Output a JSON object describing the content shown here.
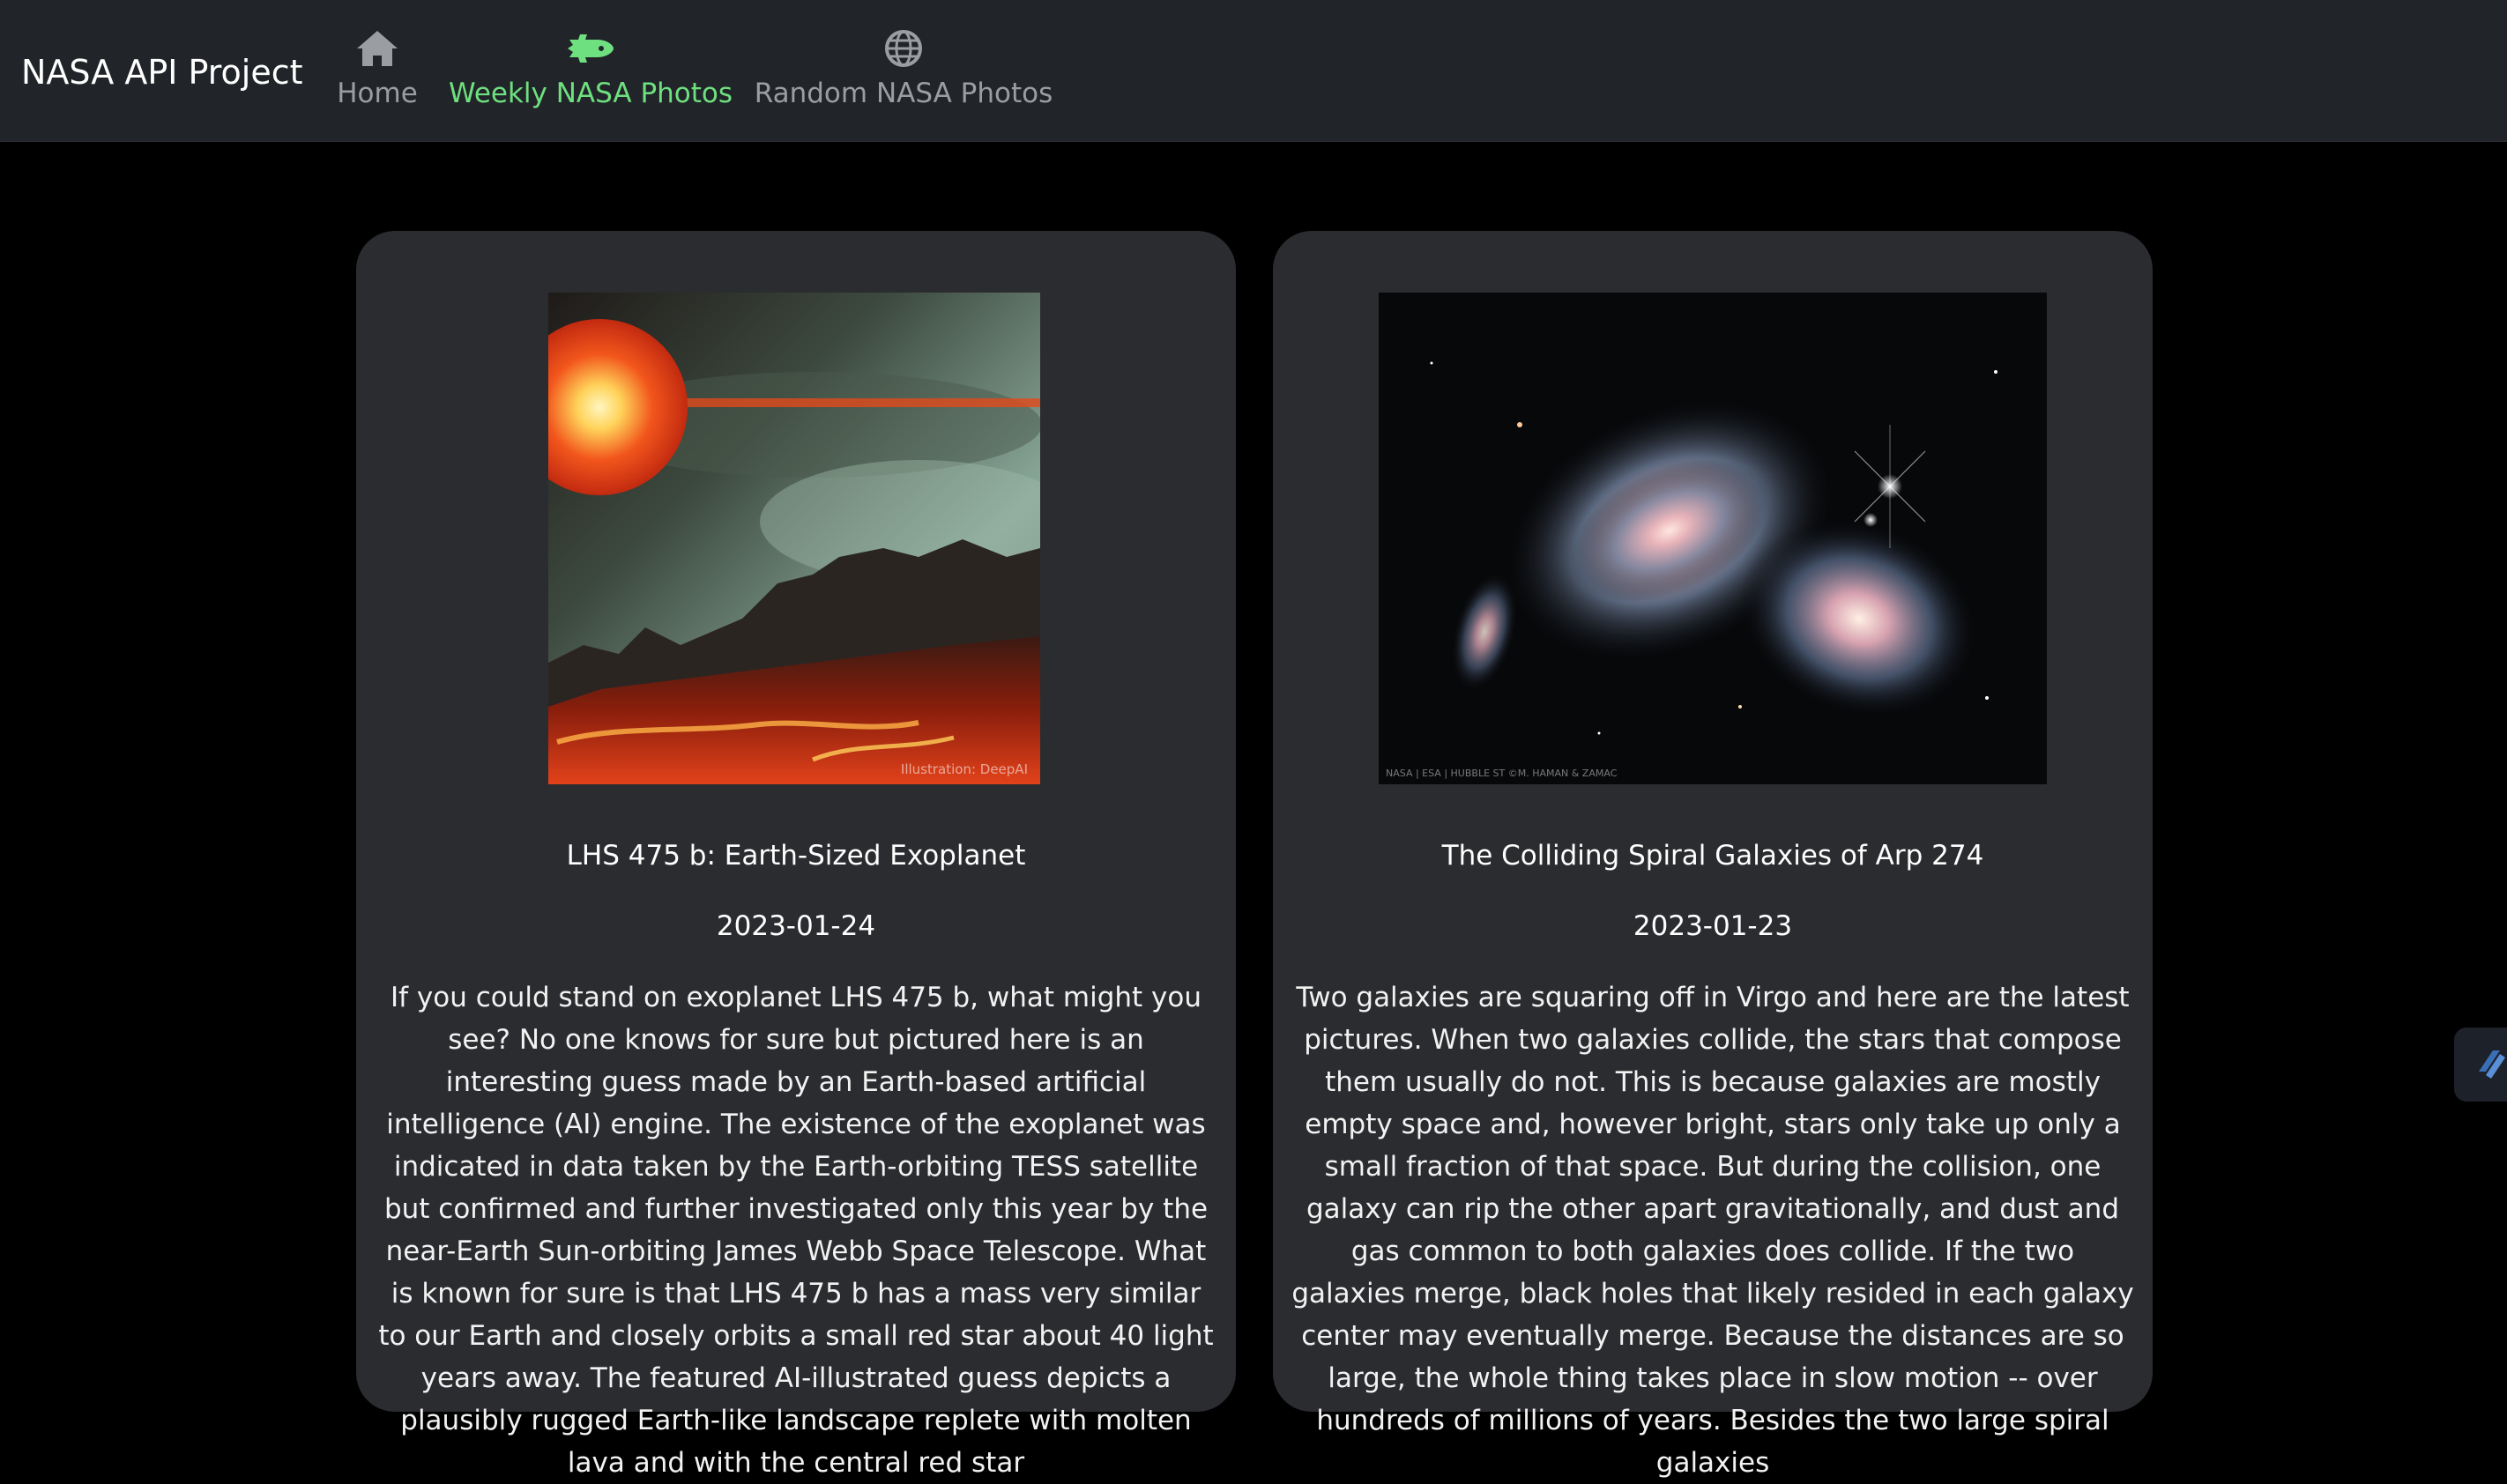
{
  "navbar": {
    "brand": "NASA API Project",
    "items": [
      {
        "label": "Home",
        "icon": "home-icon",
        "active": false
      },
      {
        "label": "Weekly NASA Photos",
        "icon": "space-shuttle-icon",
        "active": true
      },
      {
        "label": "Random NASA Photos",
        "icon": "globe-icon",
        "active": false
      }
    ],
    "active_color": "#6fe07f",
    "inactive_color": "#9a9da1",
    "background": "#212529"
  },
  "cards": [
    {
      "title": "LHS 475 b: Earth-Sized Exoplanet",
      "date": "2023-01-24",
      "image_credit": "Illustration: DeepAI",
      "description": "If you could stand on exoplanet LHS 475 b, what might you see? No one knows for sure but pictured here is an interesting guess made by an Earth-based artificial intelligence (AI) engine. The existence of the exoplanet was indicated in data taken by the Earth-orbiting TESS satellite but confirmed and further investigated only this year by the near-Earth Sun-orbiting James Webb Space Telescope. What is known for sure is that LHS 475 b has a mass very similar to our Earth and closely orbits a small red star about 40 light years away. The featured AI-illustrated guess depicts a plausibly rugged Earth-like landscape replete with molten lava and with the central red star"
    },
    {
      "title": "The Colliding Spiral Galaxies of Arp 274",
      "date": "2023-01-23",
      "image_credit": "NASA | ESA | HUBBLE ST ©M. HAMAN & ZAMAC",
      "description": "Two galaxies are squaring off in Virgo and here are the latest pictures. When two galaxies collide, the stars that compose them usually do not. This is because galaxies are mostly empty space and, however bright, stars only take up only a small fraction of that space. But during the collision, one galaxy can rip the other apart gravitationally, and dust and gas common to both galaxies does collide. If the two galaxies merge, black holes that likely resided in each galaxy center may eventually merge. Because the distances are so large, the whole thing takes place in slow motion -- over hundreds of millions of years. Besides the two large spiral galaxies"
    }
  ],
  "side_widget": {
    "icon": "translate-tool-icon"
  }
}
